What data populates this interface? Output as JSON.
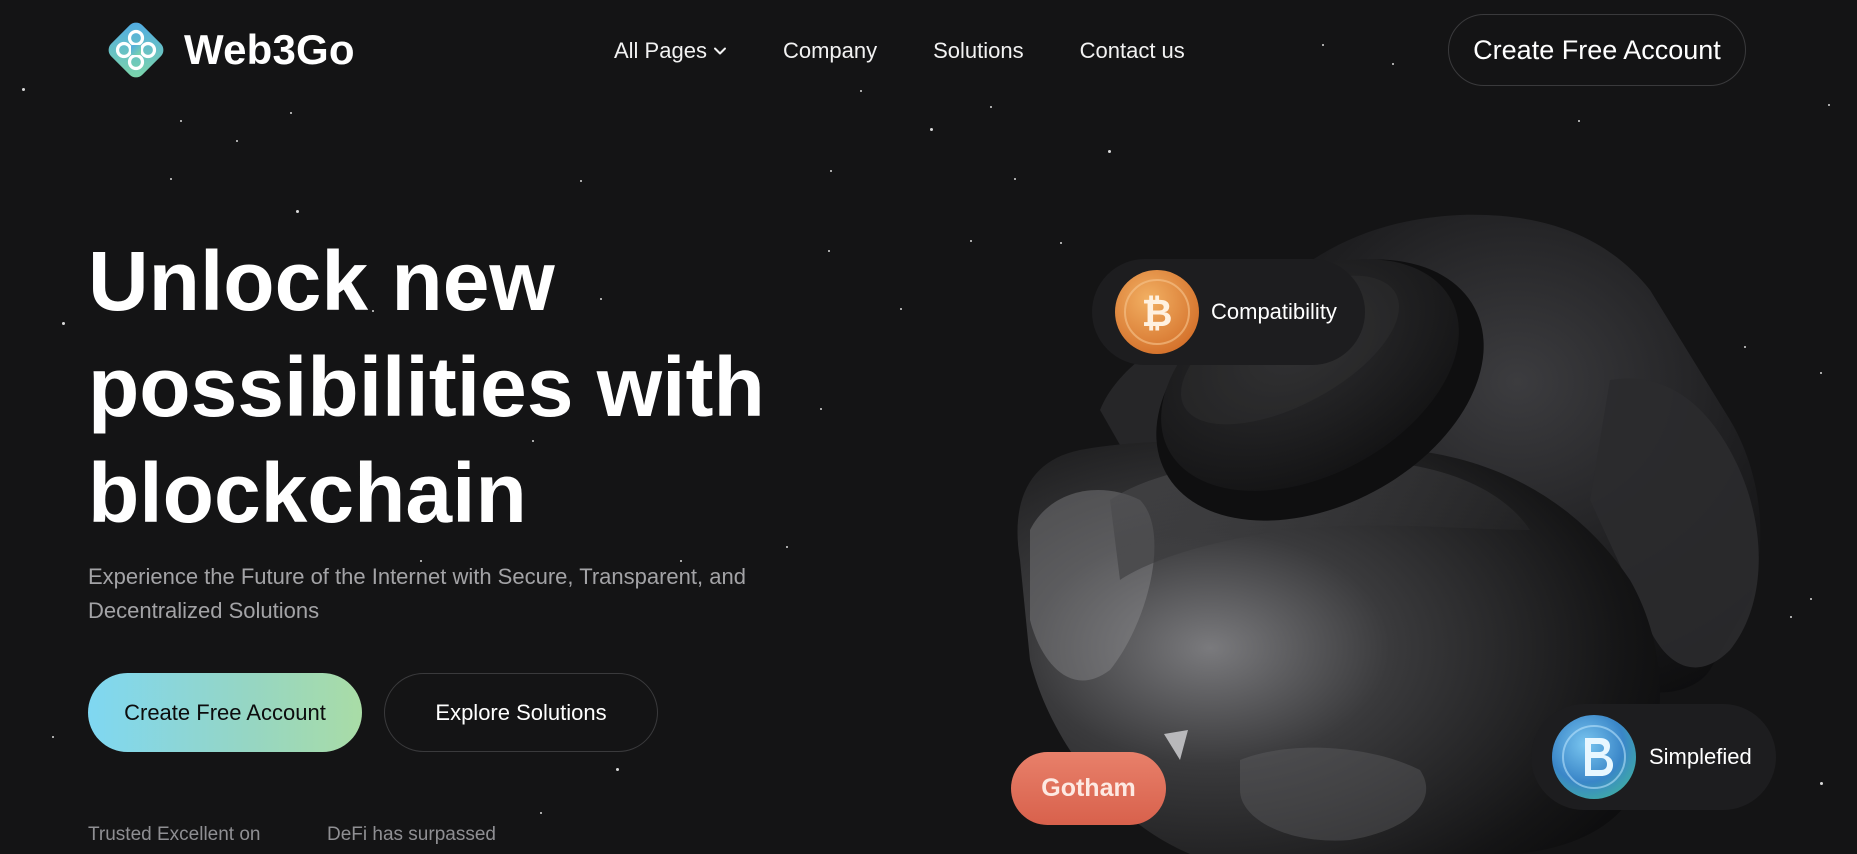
{
  "header": {
    "brand": "Web3Go",
    "nav": [
      {
        "label": "All Pages",
        "has_dropdown": true
      },
      {
        "label": "Company"
      },
      {
        "label": "Solutions"
      },
      {
        "label": "Contact us"
      }
    ],
    "cta_label": "Create Free Account"
  },
  "hero": {
    "title": "Unlock new possibilities with blockchain",
    "subtitle": "Experience the Future of the Internet with Secure, Transparent, and Decentralized Solutions",
    "primary_button": "Create Free Account",
    "secondary_button": "Explore Solutions",
    "stats": [
      "Trusted Excellent on",
      "DeFi has surpassed"
    ]
  },
  "badges": {
    "compatibility": "Compatibility",
    "simplified": "Simplefied",
    "gotham": "Gotham"
  },
  "colors": {
    "background": "#141415",
    "button_gradient": [
      "#7fd7f2",
      "#a9dca6"
    ],
    "gotham_badge": "#e0705a",
    "bitcoin_coin": "#e58a36",
    "simplified_coin": "#4aa0d8"
  },
  "icons": [
    "web3go-logo-icon",
    "chevron-down-icon",
    "bitcoin-icon",
    "simplified-coin-icon"
  ]
}
